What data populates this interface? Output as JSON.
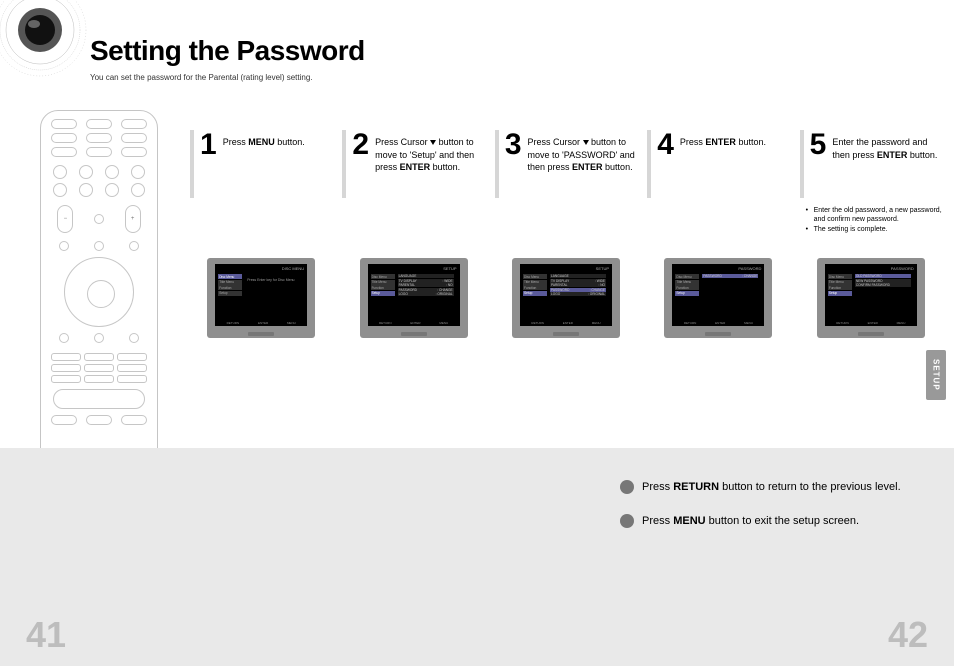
{
  "title": "Setting the Password",
  "subtitle": "You can set the password for the Parental (rating level) setting.",
  "side_tab": "SETUP",
  "page_left": "41",
  "page_right": "42",
  "steps": [
    {
      "num": "1",
      "text_parts": [
        "Press ",
        "MENU",
        " button."
      ]
    },
    {
      "num": "2",
      "text_parts": [
        "Press Cursor ",
        "▾",
        " button to move to 'Setup' and then press ",
        "ENTER",
        " button."
      ]
    },
    {
      "num": "3",
      "text_parts": [
        "Press Cursor ",
        "▾",
        " button to move to 'PASSWORD' and then press ",
        "ENTER",
        " button."
      ]
    },
    {
      "num": "4",
      "text_parts": [
        "Press ",
        "ENTER",
        " button."
      ]
    },
    {
      "num": "5",
      "text_parts": [
        "Enter the password and then press ",
        "ENTER",
        " button."
      ]
    }
  ],
  "notes_after_step5": [
    "Enter the old password, a new password, and confirm new password.",
    "The setting is complete."
  ],
  "footer_notes": [
    {
      "parts": [
        "Press ",
        "RETURN",
        " button to return to the previous level."
      ]
    },
    {
      "parts": [
        "Press ",
        "MENU",
        " button to exit the setup screen."
      ]
    }
  ],
  "tv_menus": {
    "left_items": [
      "Disc Menu",
      "Title Menu",
      "Function",
      "Setup"
    ],
    "step1_title": "DISC MENU",
    "step1_center": "Press Enter key\nfor Disc Menu",
    "setup_title": "SETUP",
    "setup_rows": [
      {
        "k": "LANGUAGE",
        "v": ""
      },
      {
        "k": "TV DISPLAY",
        "v": ": WIDE"
      },
      {
        "k": "PARENTAL",
        "v": ": NO"
      },
      {
        "k": "PASSWORD",
        "v": ": CHANGE"
      },
      {
        "k": "LOGO",
        "v": ": ORIGINAL"
      }
    ],
    "password_title": "PASSWORD",
    "password_rows": [
      {
        "k": "PASSWORD",
        "v": ": CHANGE"
      }
    ],
    "change_title": "PASSWORD",
    "change_rows": [
      {
        "k": "OLD PASSWORD",
        "v": ""
      },
      {
        "k": "NEW PASSWORD",
        "v": ""
      },
      {
        "k": "CONFIRM PASSWORD",
        "v": ""
      }
    ],
    "footer_hints": [
      "RETURN",
      "ENTER",
      "MENU"
    ]
  }
}
